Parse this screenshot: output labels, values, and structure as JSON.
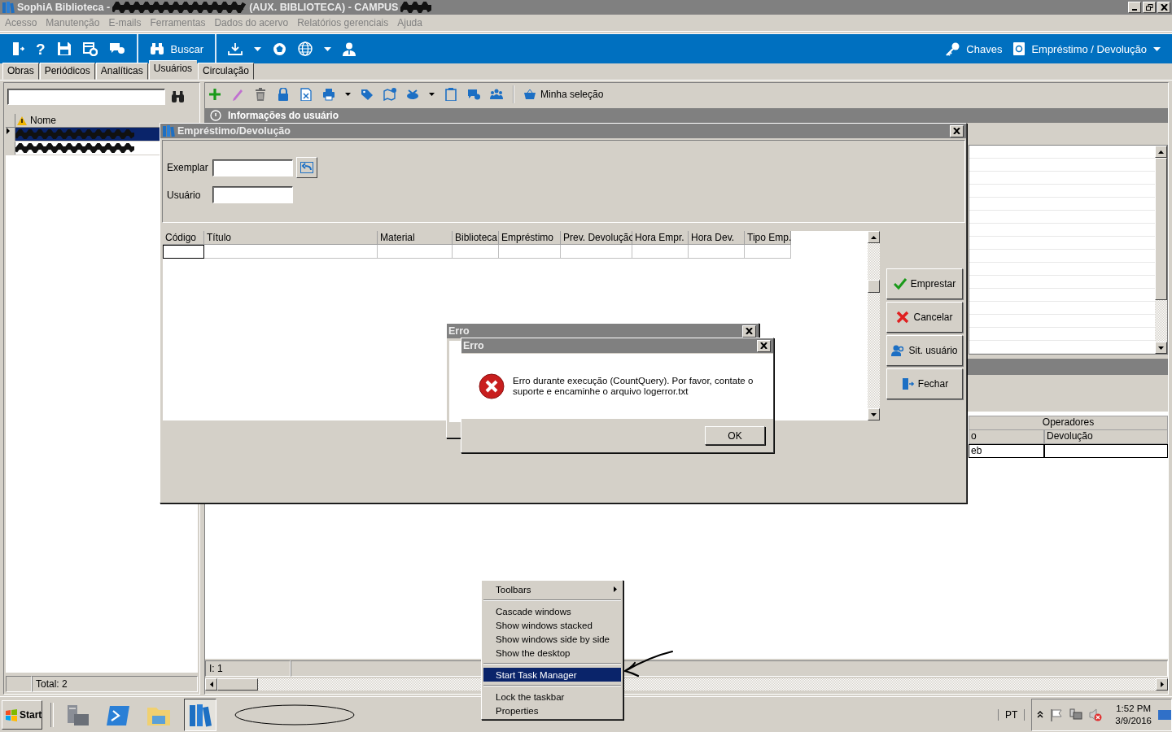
{
  "window": {
    "title_prefix": "SophiA Biblioteca -",
    "title_suffix": "(AUX. BIBLIOTECA) - CAMPUS"
  },
  "menu": [
    "Acesso",
    "Manutenção",
    "E-mails",
    "Ferramentas",
    "Dados do acervo",
    "Relatórios gerenciais",
    "Ajuda"
  ],
  "toolbar": {
    "help_glyph": "?",
    "search_label": "Buscar",
    "right": [
      {
        "kind": "key",
        "label": "Chaves"
      },
      {
        "kind": "loan",
        "label": "Empréstimo / Devolução"
      }
    ]
  },
  "tabs": [
    {
      "label": "Obras",
      "selected": false
    },
    {
      "label": "Periódicos",
      "selected": false
    },
    {
      "label": "Analíticas",
      "selected": false
    },
    {
      "label": "Usuários",
      "selected": true
    },
    {
      "label": "Circulação",
      "selected": false
    }
  ],
  "left_panel": {
    "column": "Nome",
    "rows": [
      {
        "selected": true
      },
      {
        "selected": false
      }
    ],
    "total": "Total: 2"
  },
  "right_panel": {
    "selection_label": "Minha seleção",
    "section_title": "Informações do usuário",
    "operators": {
      "title": "Operadores",
      "columns": [
        "o",
        "Devolução"
      ],
      "row": [
        "eb"
      ]
    },
    "status": "I: 1"
  },
  "loan_dialog": {
    "title": "Empréstimo/Devolução",
    "fields": [
      {
        "label": "Exemplar",
        "lookup": true
      },
      {
        "label": "Usuário",
        "lookup": false
      }
    ],
    "columns": [
      "Código",
      "Título",
      "Material",
      "Biblioteca",
      "Empréstimo",
      "Prev. Devolução",
      "Hora Empr.",
      "Hora Dev.",
      "Tipo Emp."
    ],
    "buttons": [
      {
        "kind": "check",
        "label": "Emprestar"
      },
      {
        "kind": "cross",
        "label": "Cancelar"
      },
      {
        "kind": "user",
        "label": "Sit. usuário"
      },
      {
        "kind": "exit",
        "label": "Fechar"
      }
    ]
  },
  "error_dialogs": [
    {
      "title": "Erro"
    },
    {
      "title": "Erro",
      "message": "Erro durante execução (CountQuery). Por favor, contate o suporte e encaminhe o arquivo logerror.txt",
      "button": "OK"
    }
  ],
  "context_menu": [
    {
      "kind": "submenu",
      "label": "Toolbars",
      "selected": false
    },
    {
      "kind": "separator"
    },
    {
      "kind": "item",
      "label": "Cascade windows",
      "selected": false
    },
    {
      "kind": "item",
      "label": "Show windows stacked",
      "selected": false
    },
    {
      "kind": "item",
      "label": "Show windows side by side",
      "selected": false
    },
    {
      "kind": "item",
      "label": "Show the desktop",
      "selected": false
    },
    {
      "kind": "separator"
    },
    {
      "kind": "item",
      "label": "Start Task Manager",
      "selected": true
    },
    {
      "kind": "separator"
    },
    {
      "kind": "item",
      "label": "Lock the taskbar",
      "selected": false
    },
    {
      "kind": "item",
      "label": "Properties",
      "selected": false
    }
  ],
  "taskbar": {
    "start": "Start",
    "language": "PT",
    "time": "1:52 PM",
    "date": "3/9/2016"
  }
}
